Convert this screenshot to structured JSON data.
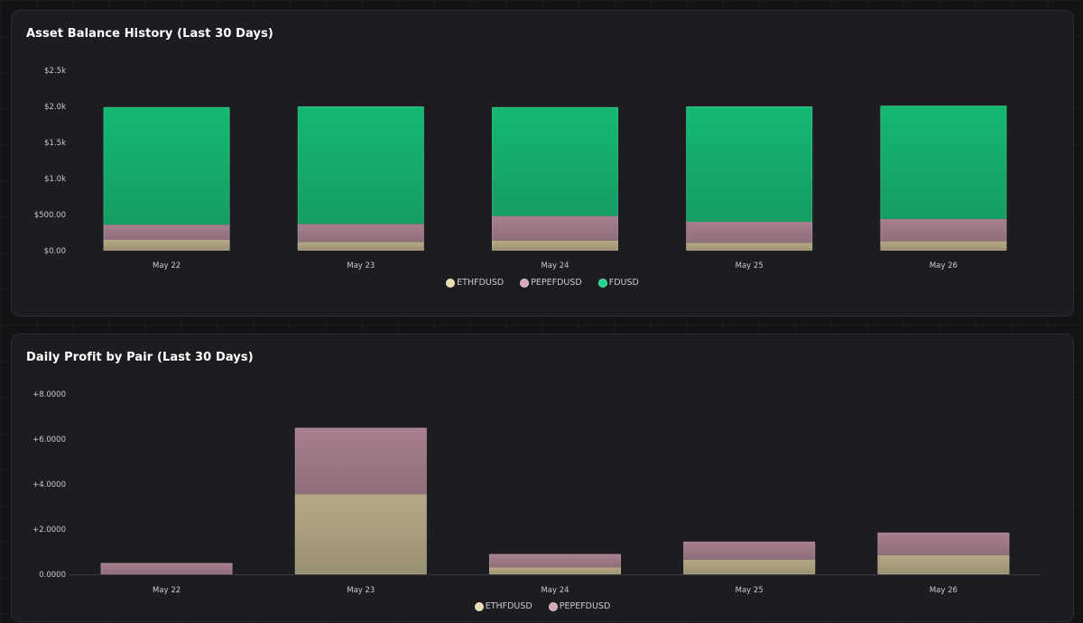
{
  "colors": {
    "ETHFDUSD": "#b5a985",
    "PEPEFDUSD": "#a87f8e",
    "FDUSD": "#14b972",
    "ETHFDUSD_swatch": "#e8dcb0",
    "PEPEFDUSD_swatch": "#d4a9b6",
    "FDUSD_swatch": "#18d98a"
  },
  "chart_data": [
    {
      "type": "bar",
      "stacked": true,
      "title": "Asset Balance History (Last 30 Days)",
      "categories": [
        "May 22",
        "May 23",
        "May 24",
        "May 25",
        "May 26"
      ],
      "series": [
        {
          "name": "ETHFDUSD",
          "values": [
            150,
            120,
            140,
            110,
            130
          ]
        },
        {
          "name": "PEPEFDUSD",
          "values": [
            210,
            250,
            340,
            290,
            310
          ]
        },
        {
          "name": "FDUSD",
          "values": [
            1630,
            1630,
            1510,
            1600,
            1570
          ]
        }
      ],
      "yticks": [
        "$0.00",
        "$500.00",
        "$1.0k",
        "$1.5k",
        "$2.0k",
        "$2.5k"
      ],
      "ylim": [
        0,
        2500
      ],
      "grid": false,
      "legend": "bottom"
    },
    {
      "type": "bar",
      "stacked": true,
      "title": "Daily Profit by Pair (Last 30 Days)",
      "categories": [
        "May 22",
        "May 23",
        "May 24",
        "May 25",
        "May 26"
      ],
      "series": [
        {
          "name": "ETHFDUSD",
          "values": [
            0.0,
            3.55,
            0.3,
            0.65,
            0.85
          ]
        },
        {
          "name": "PEPEFDUSD",
          "values": [
            0.5,
            2.95,
            0.6,
            0.8,
            1.0
          ]
        }
      ],
      "yticks": [
        "0.0000",
        "+2.0000",
        "+4.0000",
        "+6.0000",
        "+8.0000"
      ],
      "ylim": [
        0,
        8
      ],
      "grid": false,
      "legend": "bottom"
    }
  ]
}
